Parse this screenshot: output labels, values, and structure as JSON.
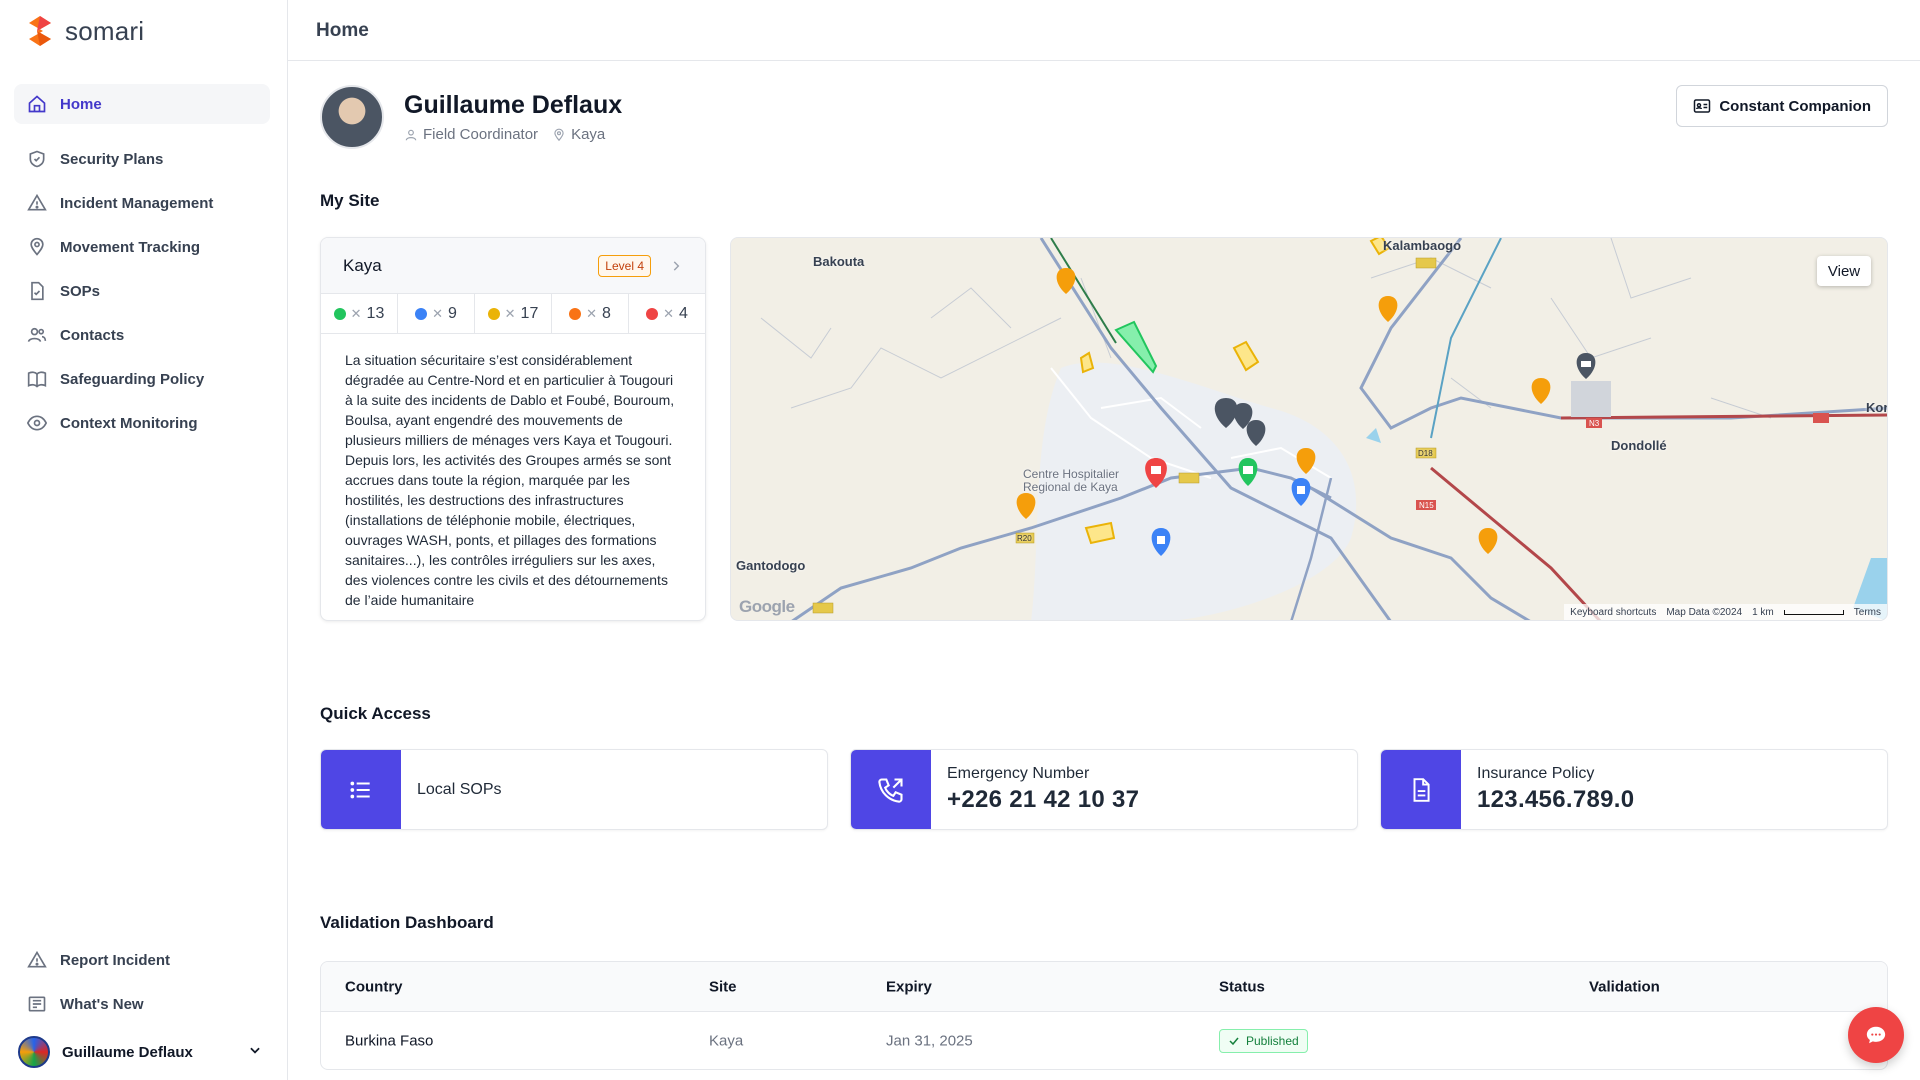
{
  "app": {
    "name": "somari"
  },
  "sidebar": {
    "items": [
      {
        "label": "Home",
        "icon": "home-icon"
      },
      {
        "label": "Security Plans",
        "icon": "shield-icon"
      },
      {
        "label": "Incident Management",
        "icon": "warning-icon"
      },
      {
        "label": "Movement Tracking",
        "icon": "location-pin-icon"
      },
      {
        "label": "SOPs",
        "icon": "document-check-icon"
      },
      {
        "label": "Contacts",
        "icon": "users-icon"
      },
      {
        "label": "Safeguarding Policy",
        "icon": "book-icon"
      },
      {
        "label": "Context Monitoring",
        "icon": "eye-icon"
      }
    ],
    "bottom": [
      {
        "label": "Report Incident",
        "icon": "warning-icon"
      },
      {
        "label": "What's New",
        "icon": "news-icon"
      }
    ],
    "user": {
      "name": "Guillaume Deflaux"
    }
  },
  "header": {
    "title": "Home"
  },
  "profile": {
    "name": "Guillaume Deflaux",
    "role": "Field Coordinator",
    "location": "Kaya",
    "companion_button": "Constant Companion"
  },
  "my_site": {
    "section_title": "My Site",
    "site_name": "Kaya",
    "level": "Level 4",
    "counts": [
      {
        "color": "#22c55e",
        "value": "13"
      },
      {
        "color": "#3b82f6",
        "value": "9"
      },
      {
        "color": "#eab308",
        "value": "17"
      },
      {
        "color": "#f97316",
        "value": "8"
      },
      {
        "color": "#ef4444",
        "value": "4"
      }
    ],
    "description": "La situation sécuritaire s’est considérablement dégradée au Centre-Nord et en particulier à Tougouri à la suite des incidents de Dablo et Foubé, Bouroum, Boulsa, ayant engendré des mouvements de plusieurs milliers de ménages vers Kaya et Tougouri.\nDepuis lors, les activités des Groupes armés se sont accrues dans toute la région, marquée par les hostilités, les destructions des infrastructures (installations de téléphonie mobile, électriques, ouvrages WASH, ponts, et pillages des formations sanitaires...), les contrôles irréguliers sur les axes, des violences contre les civils et des détournements de l’aide humanitaire"
  },
  "map": {
    "view_button": "View",
    "labels": {
      "bakouta": "Bakouta",
      "kalambaogo": "Kalambaogo",
      "dondolle": "Dondollé",
      "gantodogo": "Gantodogo",
      "hospital": "Centre Hospitalier\nRegional de Kaya",
      "kor": "Kor"
    },
    "road_labels": {
      "r20": "R20",
      "d18": "D18",
      "n15": "N15",
      "n3": "N3"
    },
    "footer": {
      "shortcuts": "Keyboard shortcuts",
      "data": "Map Data ©2024",
      "scale": "1 km",
      "terms": "Terms"
    },
    "logo": "Google"
  },
  "quick_access": {
    "section_title": "Quick Access",
    "cards": [
      {
        "label": "Local SOPs",
        "icon": "list-icon"
      },
      {
        "label": "Emergency Number",
        "value": "+226 21 42 10 37",
        "icon": "phone-icon"
      },
      {
        "label": "Insurance Policy",
        "value": "123.456.789.0",
        "icon": "file-icon"
      }
    ]
  },
  "validation": {
    "section_title": "Validation Dashboard",
    "columns": [
      "Country",
      "Site",
      "Expiry",
      "Status",
      "Validation"
    ],
    "rows": [
      {
        "country": "Burkina Faso",
        "site": "Kaya",
        "expiry": "Jan 31, 2025",
        "status": "Published",
        "validation": ""
      }
    ]
  },
  "colors": {
    "accent": "#4f46e5",
    "active_nav": "#4338ca",
    "fab": "#ef4444"
  }
}
